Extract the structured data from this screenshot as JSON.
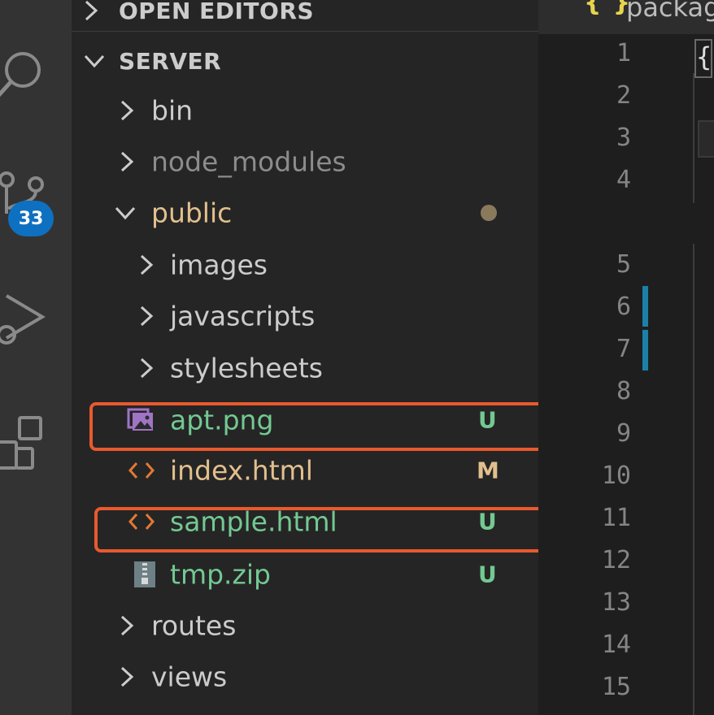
{
  "activity": {
    "badge": "33"
  },
  "explorer": {
    "open_editors_label": "OPEN EDITORS",
    "root_label": "SERVER",
    "items": [
      {
        "name": "bin",
        "type": "folder"
      },
      {
        "name": "node_modules",
        "type": "folder"
      },
      {
        "name": "public",
        "type": "folder",
        "expanded": true
      },
      {
        "name": "images",
        "type": "folder"
      },
      {
        "name": "javascripts",
        "type": "folder"
      },
      {
        "name": "stylesheets",
        "type": "folder"
      },
      {
        "name": "apt.png",
        "type": "image",
        "status": "U"
      },
      {
        "name": "index.html",
        "type": "html",
        "status": "M"
      },
      {
        "name": "sample.html",
        "type": "html",
        "status": "U"
      },
      {
        "name": "tmp.zip",
        "type": "zip",
        "status": "U"
      },
      {
        "name": "routes",
        "type": "folder"
      },
      {
        "name": "views",
        "type": "folder"
      }
    ]
  },
  "editor": {
    "tab_icon": "{ }",
    "tab_title": "package.json",
    "first_line_text": "{",
    "line_numbers": [
      "1",
      "2",
      "3",
      "4",
      "5",
      "6",
      "7",
      "8",
      "9",
      "10",
      "11",
      "12",
      "13",
      "14",
      "15"
    ]
  },
  "colors": {
    "untracked": "#73c991",
    "modified": "#e2c08d",
    "highlight_box": "#e85a2e",
    "badge": "#0e70c0"
  }
}
